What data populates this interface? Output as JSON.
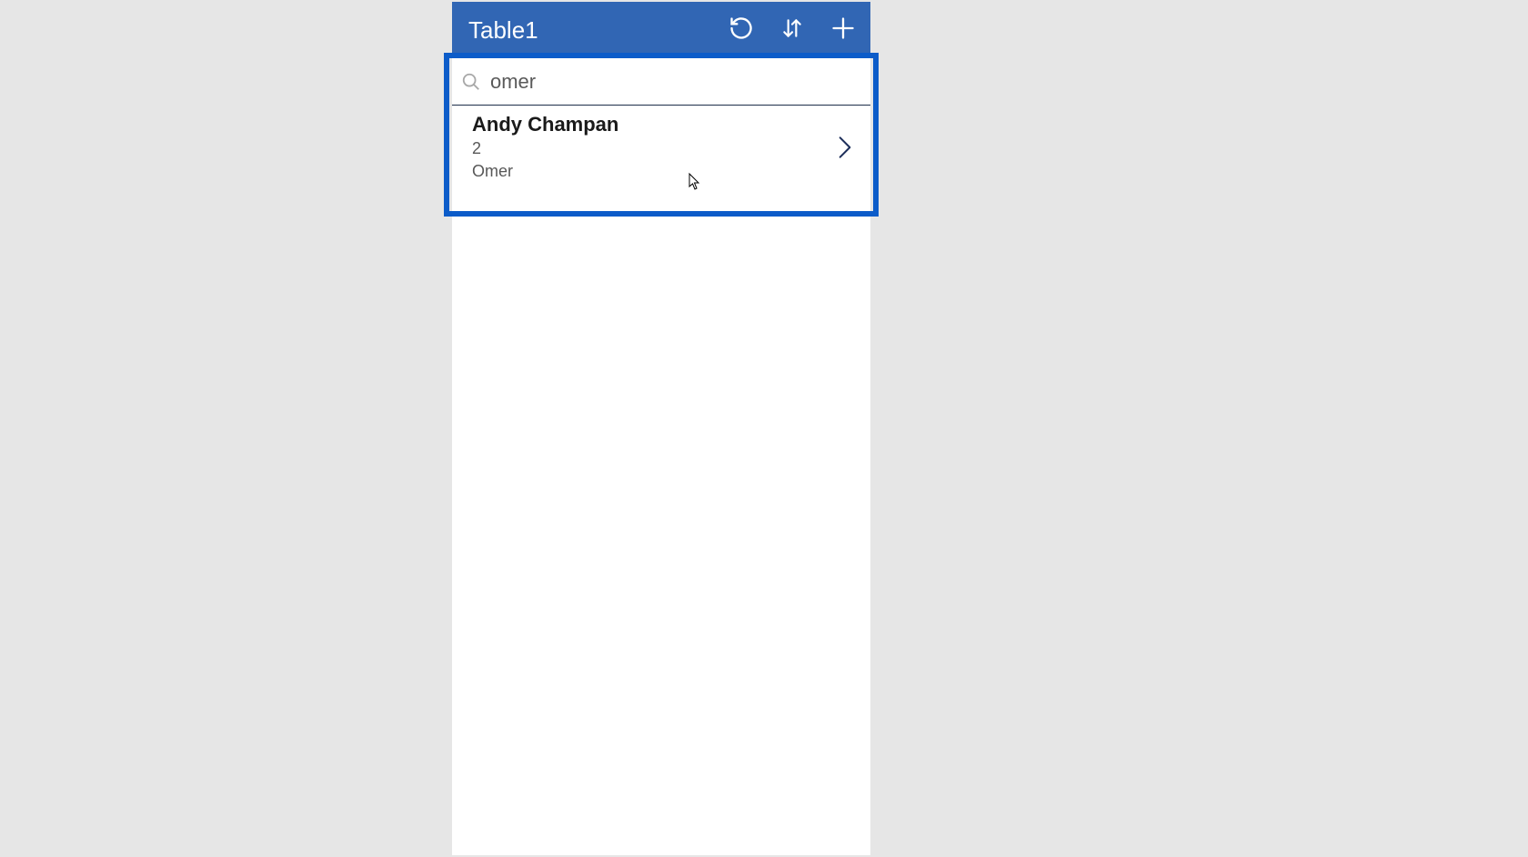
{
  "colors": {
    "header_bg": "#3166b4",
    "highlight": "#0c5cc9",
    "page_bg": "#e6e6e6"
  },
  "header": {
    "title": "Table1"
  },
  "search": {
    "value": "omer"
  },
  "results": [
    {
      "title": "Andy Champan",
      "line1": "2",
      "line2": "Omer"
    }
  ]
}
